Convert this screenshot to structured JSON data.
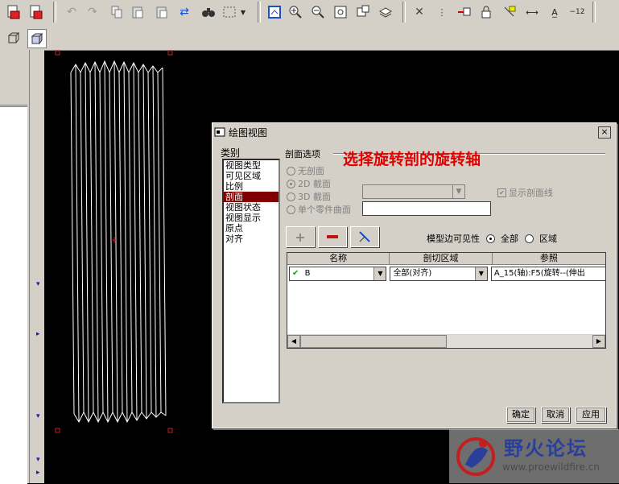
{
  "toolbar": {
    "icons": [
      "pdf-icon",
      "pdf-save-icon",
      "undo-icon",
      "redo-icon",
      "copy-icon",
      "paste-icon",
      "paste-special-icon",
      "regen-icon",
      "find-icon",
      "select-box-icon",
      "dropdown-icon",
      "sheet-icon",
      "zoom-in-icon",
      "zoom-out-icon",
      "refit-icon",
      "view-icon",
      "layer-icon",
      "close-x-icon",
      "tree-icon",
      "move-icon",
      "lock-icon",
      "flag-icon",
      "dimension-icon",
      "text-icon",
      "number-icon"
    ]
  },
  "dialog": {
    "title": "绘图视图",
    "close": "×",
    "category_label": "类别",
    "categories": [
      "视图类型",
      "可见区域",
      "比例",
      "剖面",
      "视图状态",
      "视图显示",
      "原点",
      "对齐"
    ],
    "selected_category_index": 3,
    "section_options": {
      "title": "剖面选项",
      "annotation": "选择旋转剖的旋转轴",
      "radios": [
        "无剖面",
        "2D 截面",
        "3D 截面",
        "单个零件曲面"
      ],
      "selected_radio_index": 1,
      "show_hatch_label": "显示剖面线",
      "show_hatch_checked": true
    },
    "buttons": {
      "add": "+",
      "remove": "—",
      "flip": "⁄"
    },
    "model_edge_visibility": {
      "label": "模型边可见性",
      "options": [
        "全部",
        "区域"
      ],
      "selected_index": 0
    },
    "table": {
      "headers": [
        "名称",
        "剖切区域",
        "参照"
      ],
      "rows": [
        {
          "check": "✔",
          "name": "B",
          "area": "全部(对齐)",
          "ref": "A_15(轴):F5(旋转--(伸出"
        }
      ]
    },
    "actions": {
      "ok": "确定",
      "cancel": "取消",
      "apply": "应用"
    }
  },
  "watermark": {
    "name": "野火论坛",
    "url": "www.proewildfire.cn"
  },
  "colors": {
    "annotation": "#e00000",
    "selected_category": "#800000",
    "watermark_text": "#2a3f9a",
    "canvas": "#000000"
  }
}
